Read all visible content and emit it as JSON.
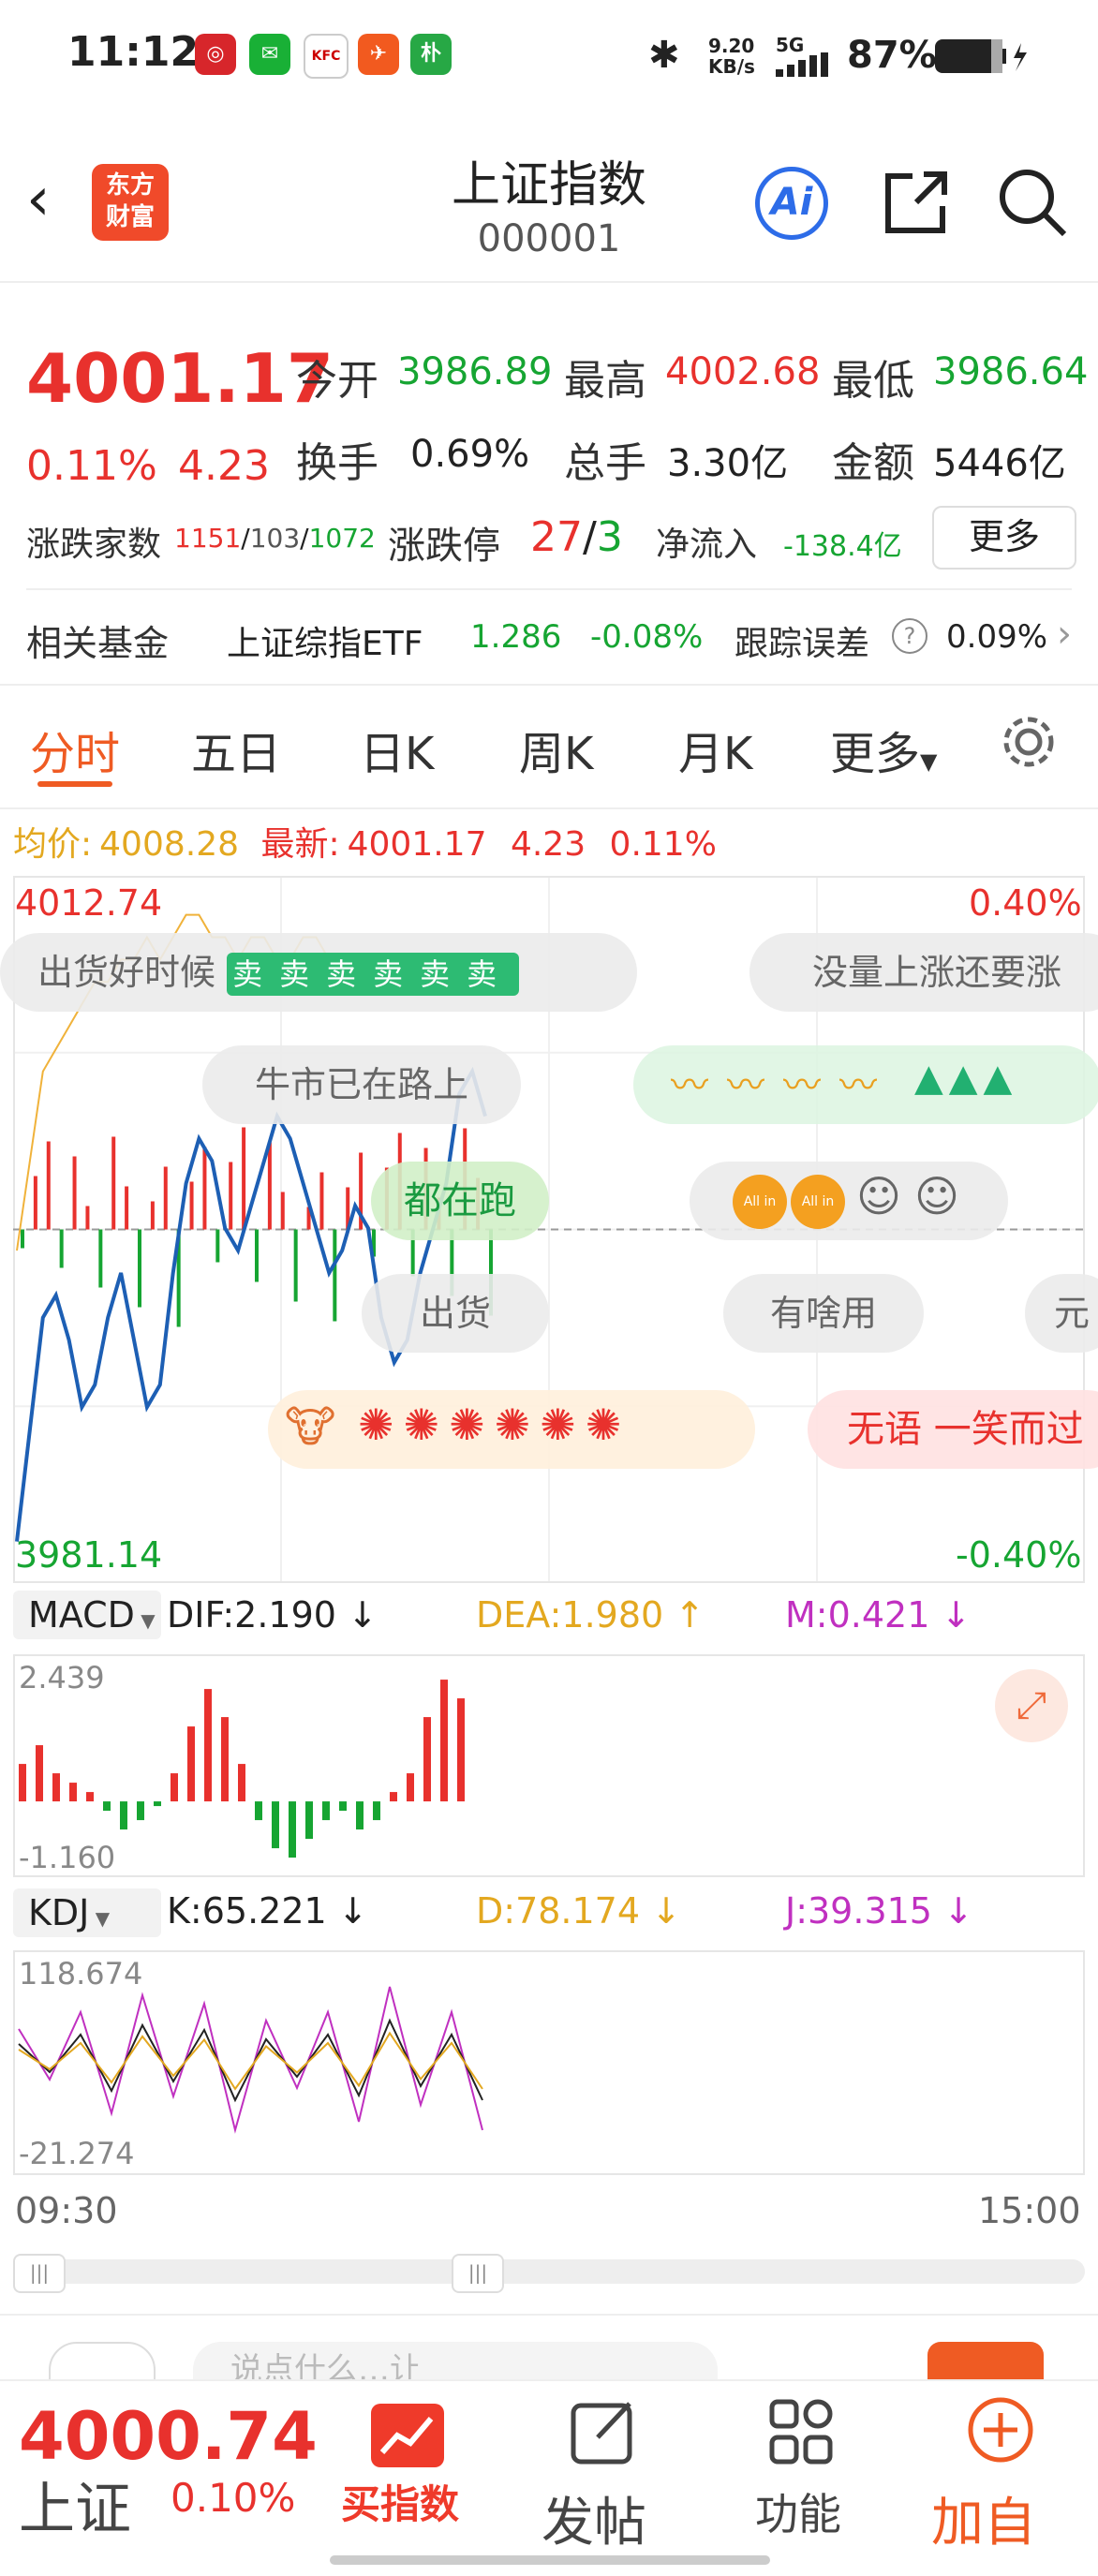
{
  "status": {
    "time": "11:12",
    "net_speed_top": "9.20",
    "net_speed_unit": "KB/s",
    "signal": "5G",
    "battery": "87%"
  },
  "header": {
    "logo": "东方\n财富",
    "title": "上证指数",
    "code": "000001",
    "ai_label": "Ai"
  },
  "quote": {
    "price": "4001.17",
    "change_pct": "0.11%",
    "change": "4.23",
    "open_label": "今开",
    "open": "3986.89",
    "high_label": "最高",
    "high": "4002.68",
    "low_label": "最低",
    "low": "3986.64",
    "turnover_label": "换手",
    "turnover": "0.69%",
    "volume_label": "总手",
    "volume": "3.30亿",
    "amount_label": "金额",
    "amount": "5446亿",
    "adv_label": "涨跌家数",
    "adv": "1151",
    "flat": "103",
    "dec": "1072",
    "limit_label": "涨跌停",
    "limit_up": "27",
    "limit_down": "3",
    "inflow_label": "净流入",
    "inflow": "-138.4亿",
    "more_label": "更多"
  },
  "fund": {
    "label": "相关基金",
    "name": "上证综指ETF",
    "price": "1.286",
    "pct": "-0.08%",
    "track_label": "跟踪误差",
    "track": "0.09%"
  },
  "tabs": [
    "分时",
    "五日",
    "日K",
    "周K",
    "月K",
    "更多"
  ],
  "chart_info": {
    "avg_label": "均价:",
    "avg": "4008.28",
    "latest_label": "最新:",
    "latest": "4001.17",
    "latest_chg": "4.23",
    "latest_pct": "0.11%"
  },
  "chart_data": {
    "type": "line",
    "y_top": "4012.74",
    "y_bottom": "3981.14",
    "pct_top": "0.40%",
    "pct_bottom": "-0.40%",
    "x_start": "09:30",
    "x_end": "15:00",
    "ylim": [
      3981.14,
      4012.74
    ],
    "prev_close": 3996.94,
    "series": [
      {
        "values": [
          3983,
          3988,
          3993,
          3994,
          3992,
          3989,
          3990,
          3993,
          3995,
          3992,
          3989,
          3990,
          3995,
          3999,
          4001,
          4000,
          3997,
          3996,
          3998,
          4000,
          4002,
          4001,
          3999,
          3997,
          3995,
          3996,
          3998,
          3997,
          3993,
          3991,
          3992,
          3995,
          3997,
          3999,
          4003,
          4004,
          4002
        ]
      },
      {
        "values": [
          3996,
          4000,
          4004,
          4005,
          4006,
          4007,
          4008,
          4008,
          4009,
          4009,
          4010,
          4009,
          4010,
          4011,
          4011,
          4010,
          4010,
          4009,
          4010,
          4010,
          4009,
          4009,
          4010,
          4010,
          4009,
          4009,
          4009,
          4009,
          4009,
          4008,
          4008,
          4009,
          4009,
          4008,
          4008,
          4008,
          4008
        ]
      }
    ]
  },
  "danmaku": [
    {
      "text": "出货好时候",
      "emoji": "卖卖卖卖卖卖"
    },
    {
      "text": "没量上涨还要涨"
    },
    {
      "text": "牛市已在路上"
    },
    {
      "text": "都在跑"
    },
    {
      "text": "出货"
    },
    {
      "text": "有啥用"
    },
    {
      "text": "无语 一笑而过"
    },
    {
      "text": "All in"
    }
  ],
  "macd": {
    "name": "MACD",
    "dif": "DIF:2.190",
    "dea": "DEA:1.980",
    "m": "M:0.421",
    "top": "2.439",
    "bottom": "-1.160"
  },
  "kdj": {
    "name": "KDJ",
    "k": "K:65.221",
    "d": "D:78.174",
    "j": "J:39.315",
    "top": "118.674",
    "bottom": "-21.274"
  },
  "bottom_bar": {
    "index_price": "4000.74",
    "index_name": "上证",
    "index_pct": "0.10%",
    "buy_index": "买指数",
    "post": "发帖",
    "func": "功能",
    "add": "加自"
  },
  "comment_placeholder": "说点什么…让"
}
